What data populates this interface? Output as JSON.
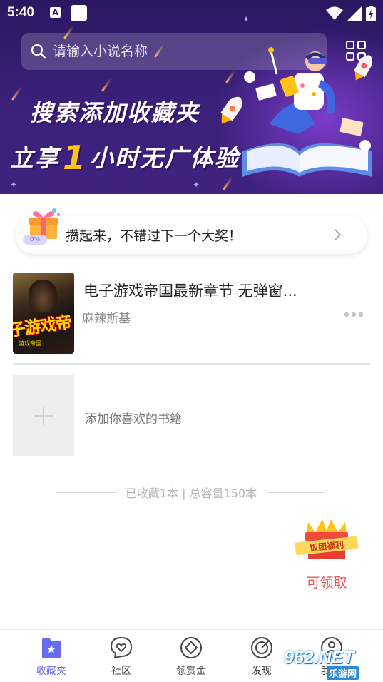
{
  "status_bar": {
    "time": "5:40",
    "a_badge": "A"
  },
  "search": {
    "placeholder": "请输入小说名称"
  },
  "banner": {
    "line1": "搜索添加收藏夹",
    "line2_before": "立享",
    "line2_number": "1",
    "line2_after": "小时无广体验"
  },
  "prize": {
    "percent": "0%",
    "text": "攒起来，不错过下一个大奖！"
  },
  "books": [
    {
      "title": "电子游戏帝国最新章节 无弹窗...",
      "author": "麻辣斯基",
      "cover_text": "子游戏帝",
      "cover_subtext": "游戏帝国"
    }
  ],
  "add_book": {
    "label": "添加你喜欢的书籍"
  },
  "capacity": {
    "text": "已收藏1本 | 总容量150本"
  },
  "reward": {
    "badge_text": "饭团福利",
    "label": "可领取"
  },
  "nav": {
    "items": [
      {
        "label": "收藏夹",
        "icon": "bookmark-star-icon",
        "active": true
      },
      {
        "label": "社区",
        "icon": "heart-chat-icon",
        "active": false
      },
      {
        "label": "领赏金",
        "icon": "coin-diamond-icon",
        "active": false
      },
      {
        "label": "发现",
        "icon": "compass-icon",
        "active": false
      },
      {
        "label": "我的",
        "icon": "user-icon",
        "active": false
      }
    ]
  },
  "watermark": {
    "logo": "962.NET",
    "sub": "乐游网"
  },
  "colors": {
    "banner_bg": "#2a1760",
    "accent": "#6a6bf0",
    "reward_red": "#e4595a",
    "highlight_yellow": "#ffc21a"
  }
}
